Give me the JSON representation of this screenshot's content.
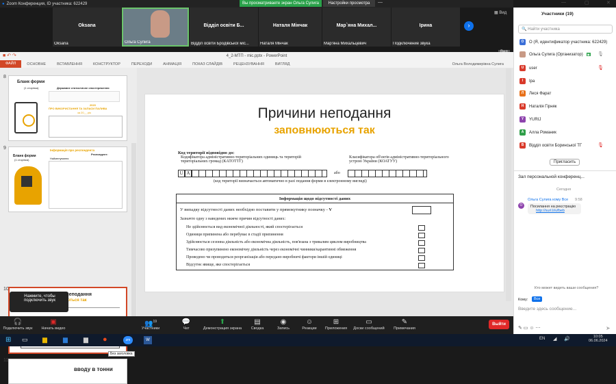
{
  "zoom": {
    "title": "Zoom Конференция, ID участника: 622429",
    "share_banner": "Вы просматриваете экран Ольга Сулига",
    "view_settings": "Настройки просмотра",
    "view_label": "Вид"
  },
  "video": {
    "tiles": [
      {
        "name": "Oksana",
        "sub": "Oksana"
      },
      {
        "name": "",
        "sub": "Ольга Сулига"
      },
      {
        "name": "Відділ освіти Б...",
        "sub": "Відділ освіти Бродівської міс..."
      },
      {
        "name": "Наталя Мінчак",
        "sub": "Наталя Мінчак"
      },
      {
        "name": "Мар`яна  Михал...",
        "sub": "Мар'яна Михальцевич"
      },
      {
        "name": "Ірина",
        "sub": "Подключение звука"
      }
    ]
  },
  "ppt": {
    "title": "4_2-МТП - mic.pptx - PowerPoint",
    "user": "Ольга Володимирівна Сулига",
    "tabs": [
      "ФАЙЛ",
      "ОСНОВНЕ",
      "ВСТАВЛЕННЯ",
      "КОНСТРУКТОР",
      "ПЕРЕХОДИ",
      "АНІМАЦІЯ",
      "ПОКАЗ СЛАЙДІВ",
      "РЕЦЕНЗУВАННЯ",
      "ВИГЛЯД"
    ],
    "thumbs": {
      "t8": {
        "num": "8",
        "title": "Бланк форми",
        "sub": "(1 сторінка)",
        "head": "Державне статистичне спостереження",
        "year": "2023",
        "mid": "ПРО ВИКОРИСТАННЯ ТА ЗАПАСИ ПАЛИВА",
        "mid2": "за 20__ рік"
      },
      "t9": {
        "num": "9",
        "top": "Інформація про респондента",
        "title": "Бланк форми",
        "sub": "(1 сторінка)",
        "resp": "Респондент:",
        "r1": "Найменування"
      },
      "t10": {
        "num": "10",
        "title": "Причини неподання",
        "sub": "заповнюються так"
      },
      "t11": {
        "num": "11",
        "title": "вводу в тонни"
      }
    },
    "tooltip": "Без заголовка"
  },
  "slide": {
    "title": "Причини неподання",
    "subtitle": "заповнюються так",
    "code_label": "Код території відповідно до:",
    "katottg": "Кодифікатора адміністративно-територіальних одиниць та територій територіальних громад (КАТОТТГ)",
    "koatuu": "Класифікатора об'єктів адміністративно-територіального устрою України (КОАТУУ)",
    "ua": "U",
    "ua2": "A",
    "or": "або",
    "auto_note": "(код території визначається автоматично в разі подання форми в електронному вигляді)",
    "box_title": "Інформація щодо відсутності даних",
    "no_data": "У випадку відсутності даних необхідно поставити у прямокутнику позначку -",
    "mark": "V",
    "reasons_head": "Зазначте одну з наведених нижче причин відсутності даних:",
    "reasons": [
      "Не здійснюється вид економічної діяльності, який спостерігається",
      "Одиниця припинена або перебуває в стадії припинення",
      "Здійснюється сезонна діяльність або економічна діяльність, пов'язана з тривалим циклом виробництва",
      "Тимчасово призупинено економічну діяльність через економічні чинники/карантинні обмеження",
      "Проведено чи проводиться реорганізація або передано виробничі фактори іншій одиниці",
      "Відсутнє явище, яке спостерігається"
    ]
  },
  "toast": {
    "text": "Нажмите, чтобы подключить звук"
  },
  "toolbar": {
    "items": [
      {
        "label": "Подключить звук",
        "icon": "headphones-icon"
      },
      {
        "label": "Начать видео",
        "icon": "camera-off-icon"
      },
      {
        "label": "Участники",
        "icon": "people-icon",
        "count": "19"
      },
      {
        "label": "Чат",
        "icon": "chat-icon"
      },
      {
        "label": "Демонстрация экрана",
        "icon": "share-icon"
      },
      {
        "label": "Сводка",
        "icon": "summary-icon"
      },
      {
        "label": "Запись",
        "icon": "record-icon"
      },
      {
        "label": "Реакции",
        "icon": "reaction-icon"
      },
      {
        "label": "Приложения",
        "icon": "apps-icon"
      },
      {
        "label": "Доски сообщений",
        "icon": "whiteboard-icon"
      },
      {
        "label": "Примечания",
        "icon": "notes-icon"
      }
    ],
    "exit": "Выйти"
  },
  "participants": {
    "header": "Участники (19)",
    "search_placeholder": "Найти участника",
    "list": [
      {
        "initial": "О",
        "name": "О (Я, идентификатор участника: 622429)",
        "color": "#3b6fd8"
      },
      {
        "initial": "",
        "name": "Ольга Сулига (Организатор)",
        "color": "#888"
      },
      {
        "initial": "U",
        "name": "user",
        "color": "#d93a2b"
      },
      {
        "initial": "I",
        "name": "Іра",
        "color": "#d93a2b"
      },
      {
        "initial": "Л",
        "name": "Леся Фарат",
        "color": "#e8711a"
      },
      {
        "initial": "Н",
        "name": "Наталія Гірняк",
        "color": "#d93a2b"
      },
      {
        "initial": "Y",
        "name": "YURIJ",
        "color": "#8e44ad"
      },
      {
        "initial": "А",
        "name": "Алла Романик",
        "color": "#2e9e48"
      },
      {
        "initial": "В",
        "name": "Відділ освіти Боринської ТГ",
        "color": "#d93a2b"
      }
    ],
    "invite": "Пригласить"
  },
  "chat": {
    "header": "Зал персональной конференц...",
    "today": "Сегодня",
    "from": "Ольга Сулига кому Все",
    "time": "9:58",
    "msg": "Посилання на реєстрацію",
    "link": "http://surl.li/ufbeb",
    "who_sees": "Кто может видеть ваши сообщения?",
    "to_label": "Кому:",
    "to_value": "Все",
    "placeholder": "Введите здесь сообщение..."
  },
  "taskbar": {
    "lang": "EN",
    "time": "10:05",
    "date": "06.06.2024"
  }
}
